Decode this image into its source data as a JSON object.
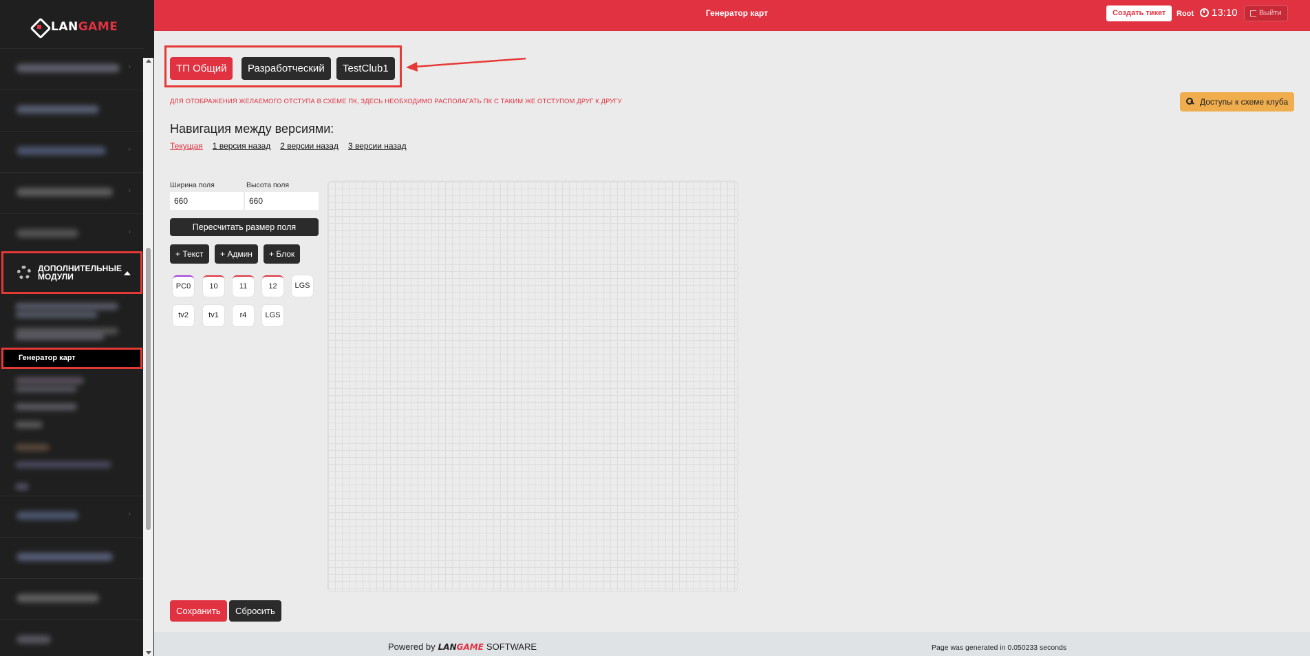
{
  "brand": {
    "lan": "LAN",
    "game": "GAME"
  },
  "topbar": {
    "title": "Генератор карт",
    "create_ticket": "Создать тикет",
    "user": "Root",
    "time": "13:10",
    "logout": "Выйти"
  },
  "sidebar": {
    "section_label": "Дополнительные модули",
    "active_item": "Генератор карт"
  },
  "clubs": [
    "ТП Общий",
    "Разработческий",
    "TestClub1"
  ],
  "warning": "ДЛЯ ОТОБРАЖЕНИЯ ЖЕЛАЕМОГО ОТСТУПА В СХЕМЕ ПК, ЗДЕСЬ НЕОБХОДИМО РАСПОЛАГАТЬ ПК С ТАКИМ ЖЕ ОТСТУПОМ ДРУГ К ДРУГУ",
  "access_button": "Доступы к схеме клуба",
  "versions": {
    "title": "Навигация между версиями:",
    "items": [
      "Текущая",
      "1 версия назад",
      "2 версии назад",
      "3 версии назад"
    ]
  },
  "field": {
    "width_label": "Ширина поля",
    "width_value": "660",
    "height_label": "Высота поля",
    "height_value": "660",
    "resize_button": "Пересчитать размер поля"
  },
  "add_buttons": [
    "+ Текст",
    "+ Админ",
    "+ Блок"
  ],
  "tokens": [
    "PC0",
    "10",
    "11",
    "12",
    "LGS",
    "tv2",
    "tv1",
    "r4",
    "LGS"
  ],
  "actions": {
    "save": "Сохранить",
    "reset": "Сбросить"
  },
  "footer": {
    "powered_prefix": "Powered by",
    "software": "SOFTWARE",
    "generated": "Page was generated in 0.050233 seconds"
  },
  "colors": {
    "accent": "#e03240",
    "dark": "#2b2b2b",
    "warning_button": "#f0ad4e"
  }
}
